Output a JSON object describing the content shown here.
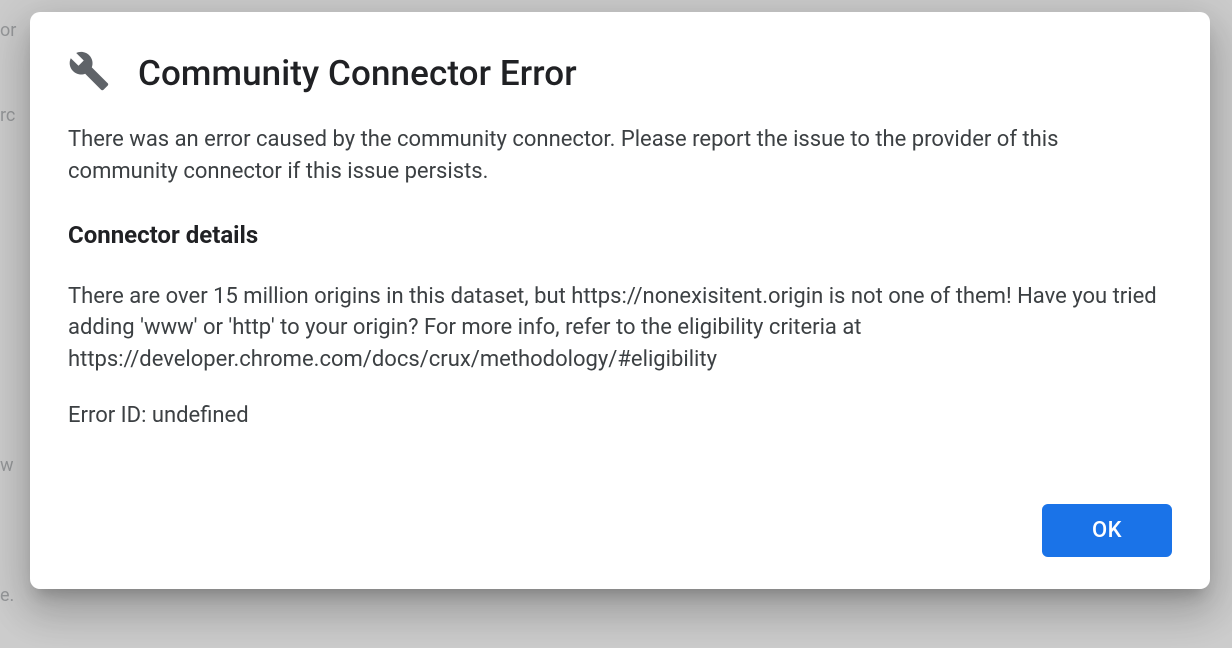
{
  "dialog": {
    "title": "Community Connector Error",
    "intro": "There was an error caused by the community connector. Please report the issue to the provider of this community connector if this issue persists.",
    "details_heading": "Connector details",
    "detail_message": "There are over 15 million origins in this dataset, but https://nonexisitent.origin is not one of them! Have you tried adding 'www' or 'http' to your origin? For more info, refer to the eligibility criteria at https://developer.chrome.com/docs/crux/methodology/#eligibility",
    "error_id": "Error ID: undefined",
    "ok_label": "OK"
  },
  "background": {
    "fragment1": "or",
    "fragment2": "rc",
    "fragment3": "w",
    "fragment4": "e."
  }
}
